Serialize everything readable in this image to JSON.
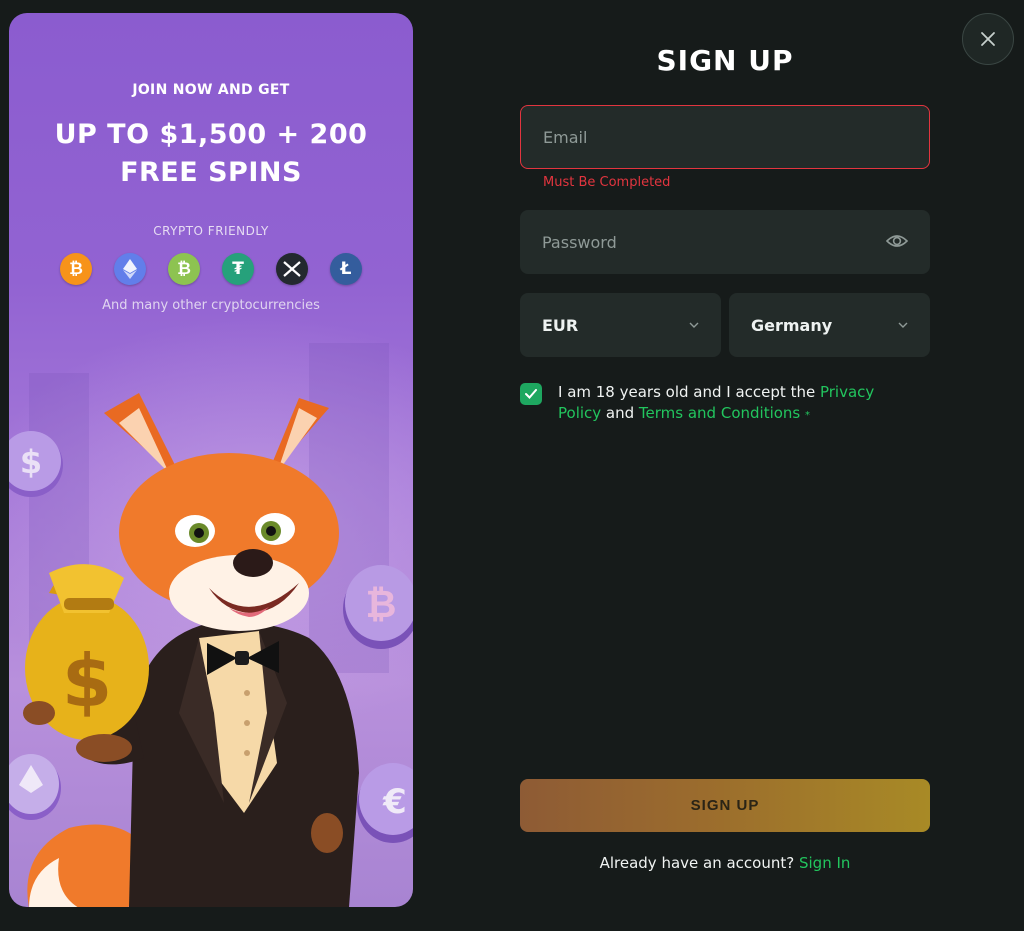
{
  "promo": {
    "join_text": "JOIN NOW AND GET",
    "amount_line1": "UP TO $1,500 + 200",
    "amount_line2": "FREE SPINS",
    "crypto_label": "CRYPTO FRIENDLY",
    "coins": [
      {
        "name": "bitcoin-icon",
        "glyph": "₿",
        "color": "#f7931a"
      },
      {
        "name": "ethereum-icon",
        "glyph": "◆",
        "color": "#627eea"
      },
      {
        "name": "bitcoin-cash-icon",
        "glyph": "₿",
        "color": "#8dc351"
      },
      {
        "name": "tether-icon",
        "glyph": "₮",
        "color": "#26a17b"
      },
      {
        "name": "xrp-icon",
        "glyph": "✕",
        "color": "#23292f"
      },
      {
        "name": "litecoin-icon",
        "glyph": "Ł",
        "color": "#345d9d"
      }
    ],
    "many_text": "And many other cryptocurrencies"
  },
  "form": {
    "title": "SIGN UP",
    "email_placeholder": "Email",
    "email_error": "Must Be Completed",
    "password_placeholder": "Password",
    "currency": "EUR",
    "country": "Germany",
    "terms_prefix": "I am 18 years old and I accept the ",
    "privacy_link": "Privacy Policy",
    "terms_and": " and ",
    "terms_link": "Terms and Conditions",
    "required_mark": "*",
    "submit_label": "SIGN UP",
    "already_text": "Already have an account? ",
    "signin_link": "Sign In"
  },
  "colors": {
    "accent_green": "#22c55e",
    "error_red": "#e2353f",
    "background": "#161b1a"
  }
}
